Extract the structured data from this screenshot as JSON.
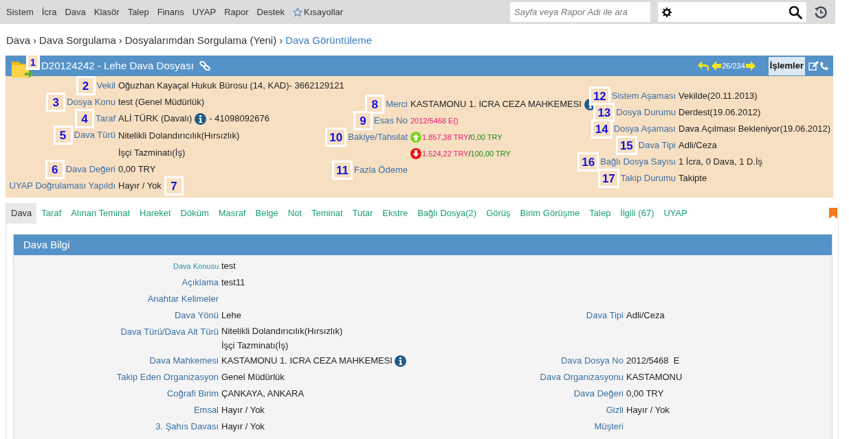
{
  "top_menu": [
    {
      "label": "Sistem"
    },
    {
      "label": "İcra"
    },
    {
      "label": "Dava"
    },
    {
      "label": "Klasör"
    },
    {
      "label": "Talep"
    },
    {
      "label": "Finans"
    },
    {
      "label": "UYAP"
    },
    {
      "label": "Rapor"
    },
    {
      "label": "Destek"
    },
    {
      "label": "Kısayollar",
      "kind": "star"
    }
  ],
  "page_search": {
    "placeholder": "Sayfa veya Rapor Adı ile ara"
  },
  "breadcrumb": [
    {
      "label": "Dava",
      "current": false
    },
    {
      "separator": "›",
      "label": "Dava Sorgulama",
      "current": false
    },
    {
      "separator": "›",
      "label": "Dosyalarımdan Sorgulama (Yeni)",
      "current": false
    },
    {
      "separator": "›",
      "label": "Dava Görüntüleme",
      "current": true
    }
  ],
  "file_header": {
    "marker": "1",
    "title": "D20124242 - Lehe Dava Dosyası",
    "counter": "26/234",
    "actions": "İşlemler"
  },
  "info_columns": [
    [
      {
        "marker": "2",
        "label": "Vekil",
        "kind": "text",
        "value": "Oğuzhan Kayaçal Hukuk Bürosu  (14, KAD)- 3662129121"
      },
      {
        "marker": "3",
        "label": "Dosya Konu",
        "kind": "text",
        "value": "test (Genel Müdürlük)"
      },
      {
        "marker": "4",
        "label": "Taraf",
        "kind": "info",
        "value": "ALİ TÜRK  (Davalı)",
        "after": "- 41098092676"
      },
      {
        "marker": "5",
        "label": "Dava Türü",
        "kind": "lines",
        "values": [
          "Nitelikli Dolandırıcılık(Hırsızlık)",
          "İşçi Tazminatı(İş)"
        ]
      },
      {
        "marker": "6",
        "label": "Dava Değeri",
        "kind": "text",
        "value": "0,00 TRY"
      },
      {
        "marker_after": "7",
        "label": "UYAP Doğrulaması Yapıldı",
        "kind": "text",
        "value": "Hayır / Yok"
      }
    ],
    [
      {
        "marker": "8",
        "label": "Merci",
        "kind": "info",
        "value": "KASTAMONU 1. ICRA CEZA MAHKEMESI"
      },
      {
        "marker": "9",
        "label": "Esas No",
        "kind": "pink",
        "value": "2012/5468 E()"
      },
      {
        "marker": "10",
        "label": "Bakiye/Tahsilat",
        "kind": "balance",
        "entries": [
          {
            "increase": true,
            "amount": "1.857,38 TRY",
            "separator": "/",
            "collected": "0,00 TRY"
          },
          {
            "increase": false,
            "amount": "1.524,22 TRY",
            "separator": "/",
            "collected": "100,00 TRY"
          }
        ]
      },
      {
        "marker": "11",
        "label": "Fazla Ödeme",
        "kind": "label"
      }
    ],
    [
      {
        "marker": "12",
        "label": "Sistem Aşaması",
        "kind": "text",
        "value": "Vekilde(20.11.2013)"
      },
      {
        "marker": "13",
        "label": "Dosya Durumu",
        "kind": "text",
        "value": "Derdest(19.06.2012)"
      },
      {
        "marker": "14",
        "label": "Dosya Aşaması",
        "kind": "text",
        "value": "Dava Açılması Bekleniyor(19.06.2012)"
      },
      {
        "marker": "15",
        "label": "Dava Tipi",
        "kind": "text",
        "value": "Adli/Ceza"
      },
      {
        "marker": "16",
        "label": "Bağlı Dosya Sayısı",
        "kind": "text",
        "value": "1 İcra, 0 Dava, 1 D.İş"
      },
      {
        "marker": "17",
        "label": "Takip Durumu",
        "kind": "text",
        "value": "Takipte"
      }
    ]
  ],
  "tabs": [
    {
      "label": "Dava",
      "selected": true
    },
    {
      "label": "Taraf",
      "selected": false
    },
    {
      "label": "Alınan Teminat",
      "selected": false
    },
    {
      "label": "Hareket",
      "selected": false
    },
    {
      "label": "Döküm",
      "selected": false
    },
    {
      "label": "Masraf",
      "selected": false
    },
    {
      "label": "Belge",
      "selected": false
    },
    {
      "label": "Not",
      "selected": false
    },
    {
      "label": "Teminat",
      "selected": false
    },
    {
      "label": "Tutar",
      "selected": false
    },
    {
      "label": "Ekstre",
      "selected": false
    },
    {
      "label": "Bağlı Dosya(2)",
      "selected": false
    },
    {
      "label": "Görüş",
      "selected": false
    },
    {
      "label": "Birim Görüşme",
      "selected": false
    },
    {
      "label": "Talep",
      "selected": false
    },
    {
      "label": "İlgili (67)",
      "selected": false
    },
    {
      "label": "UYAP",
      "selected": false
    }
  ],
  "panel": {
    "title": "Dava Bilgi",
    "rows": [
      {
        "label": "Dava Konusu",
        "small_label": true,
        "values": [
          "test"
        ]
      },
      {
        "label": "Açıklama",
        "small_label": false,
        "values": [
          "test11"
        ]
      },
      {
        "label": "Anahtar Kelimeler",
        "small_label": false,
        "values": []
      },
      {
        "label": "Dava Yönü",
        "small_label": false,
        "values": [
          "Lehe"
        ],
        "right_label": "Dava Tipi",
        "right_value": "Adli/Ceza"
      },
      {
        "label": "Dava Türü/Dava Alt Türü",
        "small_label": false,
        "values": [
          "Nitelikli Dolandırıcılık(Hırsızlık)",
          "İşçi Tazminatı(İş)"
        ]
      },
      {
        "label": "Dava Mahkemesi",
        "small_label": false,
        "values": [
          "KASTAMONU 1. ICRA CEZA MAHKEMESI"
        ],
        "info_icon": true,
        "right_label": "Dava Dosya No",
        "right_value": "2012/5468  E"
      },
      {
        "label": "Takip Eden Organizasyon",
        "small_label": false,
        "values": [
          "Genel Müdürlük"
        ],
        "right_label": "Dava Organizasyonu",
        "right_value": "KASTAMONU"
      },
      {
        "label": "Coğrafi Birim",
        "small_label": false,
        "values": [
          "ÇANKAYA, ANKARA"
        ],
        "right_label": "Dava Değeri",
        "right_value": "0,00 TRY"
      },
      {
        "label": "Emsal",
        "small_label": false,
        "values": [
          "Hayır / Yok"
        ],
        "right_label": "Gizli",
        "right_value": "Hayır / Yok"
      },
      {
        "label": "3. Şahıs Davası",
        "small_label": false,
        "values": [
          "Hayır / Yok"
        ],
        "right_label": "Müşteri"
      }
    ]
  }
}
